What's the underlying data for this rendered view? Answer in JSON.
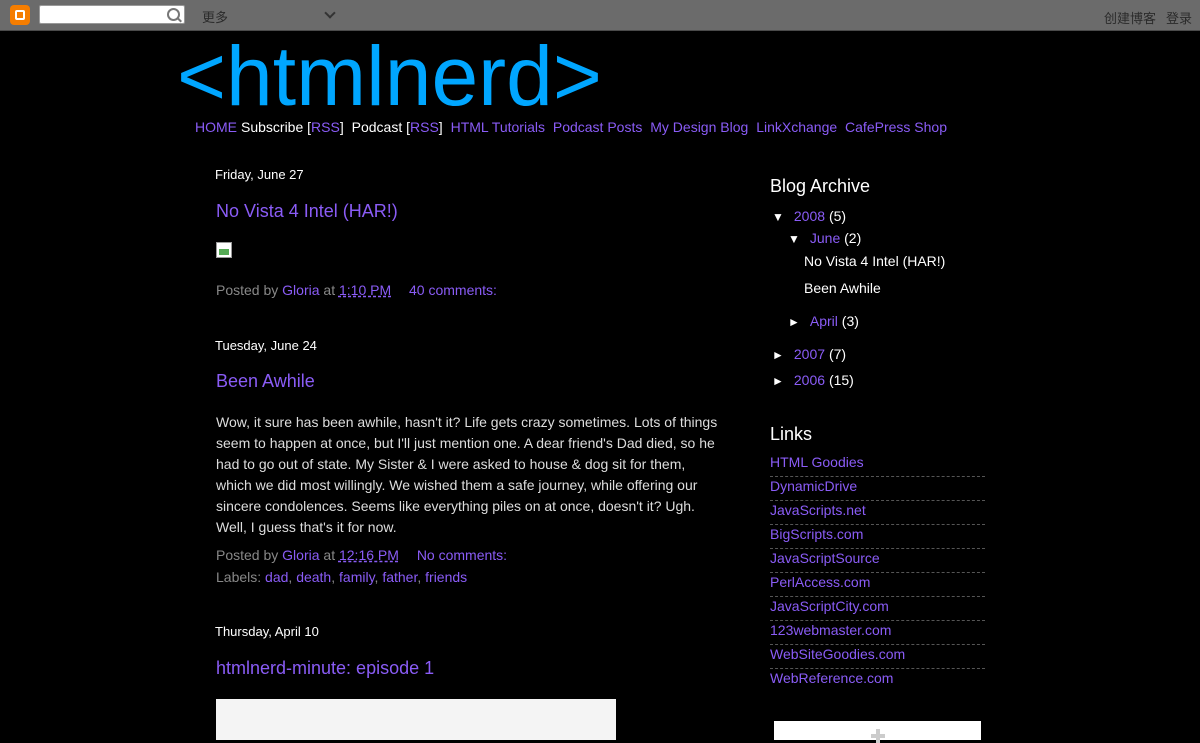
{
  "navbar": {
    "search_placeholder": "",
    "more_label": "更多",
    "create_blog_label": "创建博客",
    "login_label": "登录"
  },
  "header": {
    "title": "<htmlnerd>"
  },
  "topnav": {
    "items": [
      {
        "label": "HOME"
      },
      {
        "label": "Subscribe ["
      },
      {
        "label": "RSS"
      },
      {
        "label": "]"
      },
      {
        "label": "Podcast ["
      },
      {
        "label": "RSS"
      },
      {
        "label": "]"
      },
      {
        "label": "HTML Tutorials"
      },
      {
        "label": "Podcast Posts"
      },
      {
        "label": "My Design Blog"
      },
      {
        "label": "LinkXchange"
      },
      {
        "label": "CafePress Shop"
      }
    ]
  },
  "posts": [
    {
      "date": "Friday, June 27",
      "title": "No Vista 4 Intel (HAR!)",
      "posted_by": "Posted by",
      "author": "Gloria",
      "at": "at",
      "time": "1:10 PM",
      "comments": "40 comments:"
    },
    {
      "date": "Tuesday, June 24",
      "title": "Been Awhile",
      "body": "Wow, it sure has been awhile, hasn't it? Life gets crazy sometimes. Lots of things seem to happen at once, but I'll just mention one. A dear friend's Dad died, so he had to go out of state. My Sister & I were asked to house & dog sit for them, which we did most willingly. We wished them a safe journey, while offering our sincere condolences. Seems like everything piles on at once, doesn't it? Ugh. Well, I guess that's it for now.",
      "posted_by": "Posted by",
      "author": "Gloria",
      "at": "at",
      "time": "12:16 PM",
      "comments": "No comments:",
      "labels_prefix": "Labels:",
      "labels": [
        "dad",
        "death",
        "family",
        "father",
        "friends"
      ]
    },
    {
      "date": "Thursday, April 10",
      "title": "htmlnerd-minute: episode 1"
    }
  ],
  "sidebar": {
    "archive_title": "Blog Archive",
    "archive": {
      "y2008": {
        "year": "2008",
        "count": "(5)",
        "expanded_icon": "▼"
      },
      "june": {
        "month": "June",
        "count": "(2)",
        "expanded_icon": "▼"
      },
      "june_posts": [
        "No Vista 4 Intel (HAR!)",
        "Been Awhile"
      ],
      "april": {
        "month": "April",
        "count": "(3)",
        "collapsed_icon": "►"
      },
      "y2007": {
        "year": "2007",
        "count": "(7)",
        "collapsed_icon": "►"
      },
      "y2006": {
        "year": "2006",
        "count": "(15)",
        "collapsed_icon": "►"
      }
    },
    "links_title": "Links",
    "links": [
      "HTML Goodies",
      "DynamicDrive",
      "JavaScripts.net",
      "BigScripts.com",
      "JavaScriptSource",
      "PerlAccess.com",
      "JavaScriptCity.com",
      "123webmaster.com",
      "WebSiteGoodies.com",
      "WebReference.com"
    ]
  },
  "colors": {
    "background": "#000000",
    "title_blue": "#00a6ff",
    "link_purple": "#8a5cf6",
    "navbar_gray": "#6b6b6b"
  }
}
